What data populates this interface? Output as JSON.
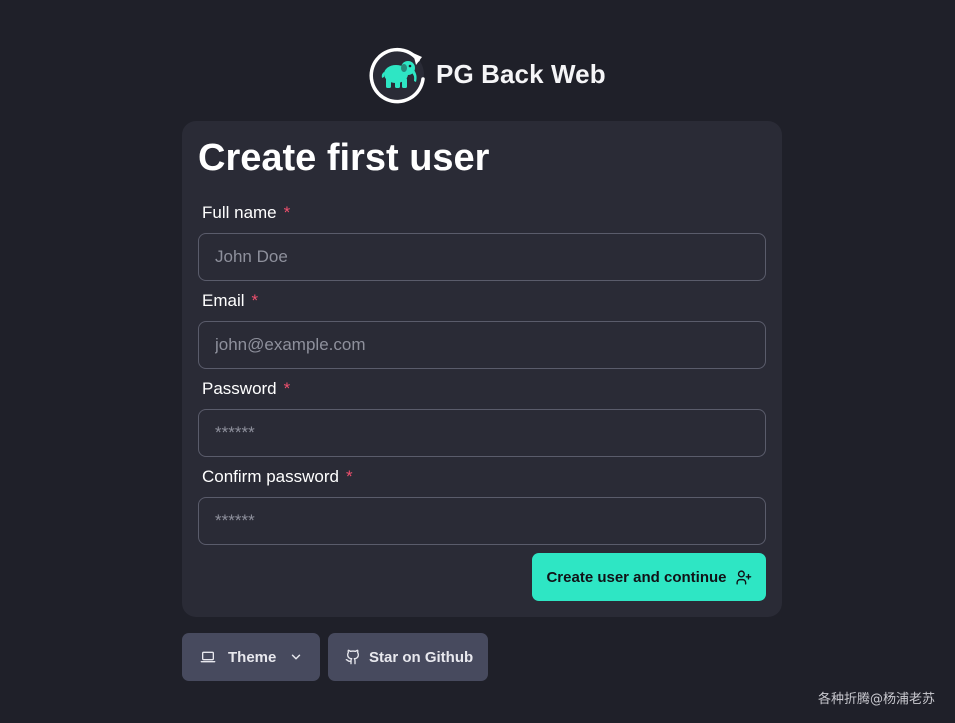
{
  "app": {
    "name": "PG Back Web",
    "logo_icon": "elephant-backup-logo-icon"
  },
  "form": {
    "title": "Create first user",
    "required_marker": "*",
    "fields": [
      {
        "label": "Full name",
        "placeholder": "John Doe",
        "value": "",
        "type": "text"
      },
      {
        "label": "Email",
        "placeholder": "john@example.com",
        "value": "",
        "type": "email"
      },
      {
        "label": "Password",
        "placeholder": "******",
        "value": "",
        "type": "password"
      },
      {
        "label": "Confirm password",
        "placeholder": "******",
        "value": "",
        "type": "password"
      }
    ],
    "submit_label": "Create user and continue",
    "submit_icon": "user-plus-icon"
  },
  "footer": {
    "theme_label": "Theme",
    "theme_icon": "laptop-icon",
    "github_label": "Star on Github",
    "github_icon": "github-icon"
  },
  "watermark": "各种折腾@杨浦老苏",
  "colors": {
    "background": "#1f2029",
    "card": "#2a2b36",
    "accent": "#2ee6c4",
    "required": "#f0506e",
    "footer_button": "#474a5e"
  }
}
